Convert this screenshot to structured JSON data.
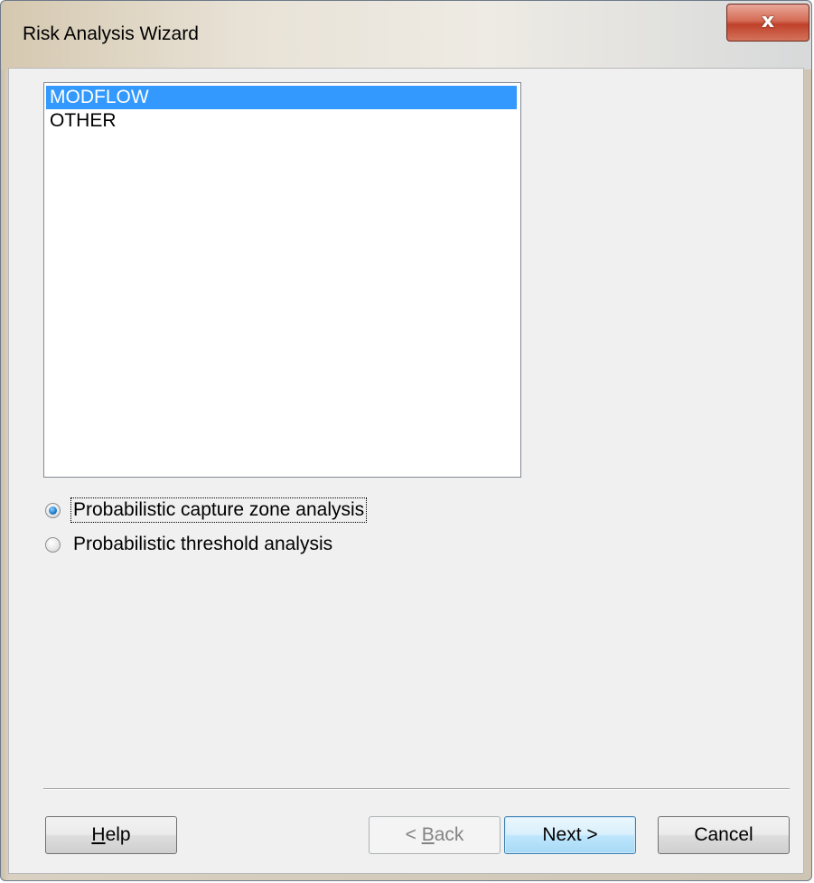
{
  "window": {
    "title": "Risk Analysis Wizard",
    "close_glyph": "x"
  },
  "model_list": {
    "items": [
      {
        "label": "MODFLOW",
        "selected": true
      },
      {
        "label": "OTHER",
        "selected": false
      }
    ]
  },
  "analysis_options": [
    {
      "label": "Probabilistic capture zone analysis",
      "checked": true,
      "focused": true
    },
    {
      "label": "Probabilistic threshold analysis",
      "checked": false,
      "focused": false
    }
  ],
  "buttons": {
    "help": {
      "mnemonic": "H",
      "rest": "elp",
      "enabled": true
    },
    "back": {
      "prefix": "< ",
      "mnemonic": "B",
      "rest": "ack",
      "enabled": false
    },
    "next": {
      "label": "Next >",
      "enabled": true,
      "default": true
    },
    "cancel": {
      "label": "Cancel",
      "enabled": true
    }
  },
  "colors": {
    "selection": "#3399ff",
    "dialog_background": "#f0f0f0",
    "close_button": "#c7402b"
  }
}
